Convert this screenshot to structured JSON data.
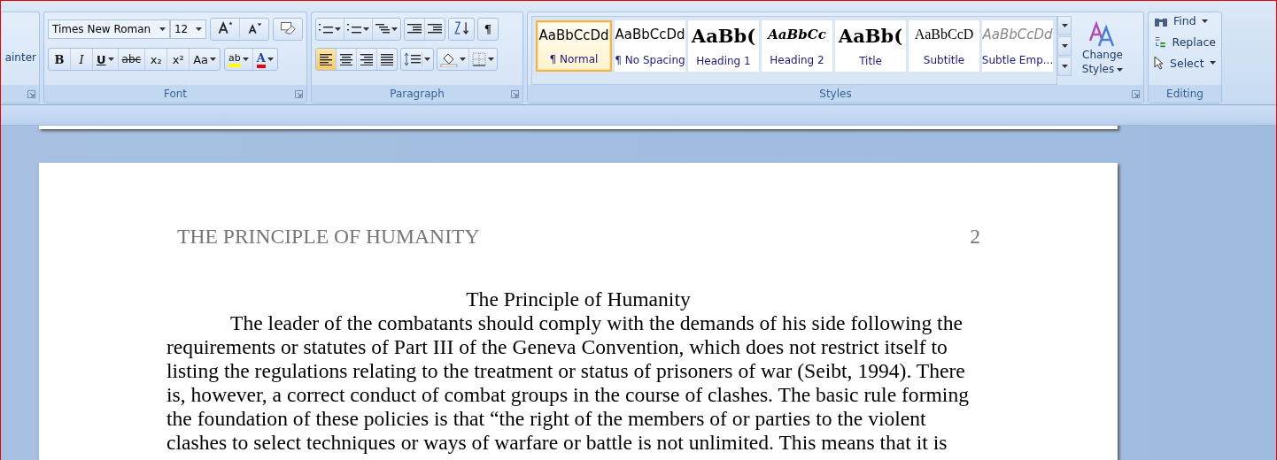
{
  "clipboard": {
    "label": "ainter"
  },
  "font": {
    "label": "Font",
    "name": "Times New Roman",
    "size": "12",
    "format_buttons": [
      {
        "kind": "bold",
        "text": "B"
      },
      {
        "kind": "italic",
        "text": "I"
      },
      {
        "kind": "underline",
        "text": "U"
      },
      {
        "kind": "strike",
        "text": "abc"
      },
      {
        "kind": "sub",
        "text": "x₂"
      },
      {
        "kind": "sup",
        "text": "x²"
      },
      {
        "kind": "case",
        "text": "Aa"
      }
    ],
    "highlight_text": "ab",
    "color_text": "A"
  },
  "paragraph": {
    "label": "Paragraph",
    "pilcrow": "¶",
    "alignments": [
      {
        "kind": "left",
        "selected": true
      },
      {
        "kind": "center",
        "selected": false
      },
      {
        "kind": "right",
        "selected": false
      },
      {
        "kind": "justify",
        "selected": false
      }
    ]
  },
  "styles": {
    "label": "Styles",
    "change_styles": "Change Styles",
    "gallery": [
      {
        "kind": "normal",
        "sample": "AaBbCcDd",
        "name": "¶ Normal",
        "selected": true
      },
      {
        "kind": "normal",
        "sample": "AaBbCcDd",
        "name": "¶ No Spacing",
        "selected": false
      },
      {
        "kind": "heading1",
        "sample": "AaBb(",
        "name": "Heading 1",
        "selected": false
      },
      {
        "kind": "heading2",
        "sample": "AaBbCc",
        "name": "Heading 2",
        "selected": false
      },
      {
        "kind": "title",
        "sample": "AaBb(",
        "name": "Title",
        "selected": false
      },
      {
        "kind": "subtitle",
        "sample": "AaBbCcD",
        "name": "Subtitle",
        "selected": false
      },
      {
        "kind": "subtle",
        "sample": "AaBbCcDd",
        "name": "Subtle Emp...",
        "selected": false
      }
    ]
  },
  "editing": {
    "label": "Editing",
    "items": [
      {
        "kind": "find",
        "label": "Find",
        "dropdown": true
      },
      {
        "kind": "replace",
        "label": "Replace",
        "dropdown": false
      },
      {
        "kind": "select",
        "label": "Select",
        "dropdown": true
      }
    ]
  },
  "document": {
    "header_title": "THE PRINCIPLE OF HUMANITY",
    "page_number": "2",
    "title": "The Principle of Humanity",
    "body": "The leader of the combatants should comply with the demands of his side following the requirements or statutes of Part III of the Geneva Convention, which does not restrict itself to listing the regulations relating to the treatment or status of prisoners of war (Seibt, 1994). There is, however, a correct conduct of combat groups in the course of clashes. The basic rule forming the foundation of these policies is that “the right of the members of or parties to the violent clashes to select techniques or ways of warfare or battle is not unlimited. This means that it is"
  }
}
